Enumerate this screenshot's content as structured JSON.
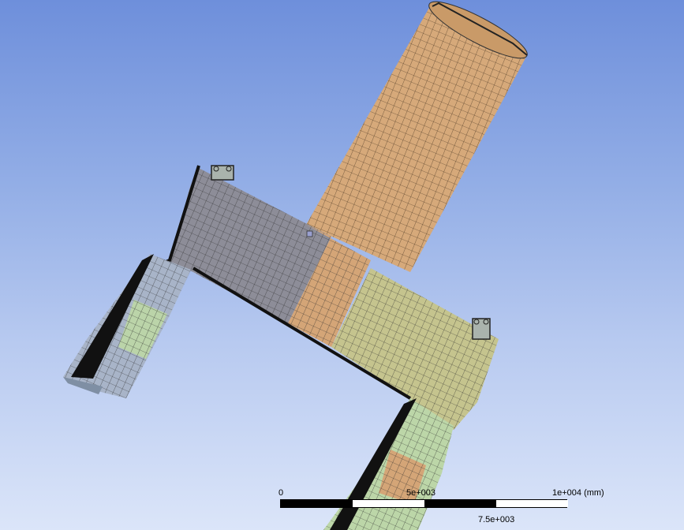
{
  "scale_bar": {
    "label_start": "0",
    "label_mid_top": "5e+003",
    "label_end": "1e+004 (mm)",
    "label_mid_bottom": "7.5e+003"
  },
  "colors": {
    "background_top": "#6e8fdb",
    "background_bottom": "#dbe5f9",
    "chimney": "#d6a97a",
    "left_block": "#8d8d98",
    "right_block": "#c5c48e",
    "left_leg": "#a8b4c8",
    "support_green": "#bcd6a8",
    "mesh_line": "#2b2b2b"
  }
}
